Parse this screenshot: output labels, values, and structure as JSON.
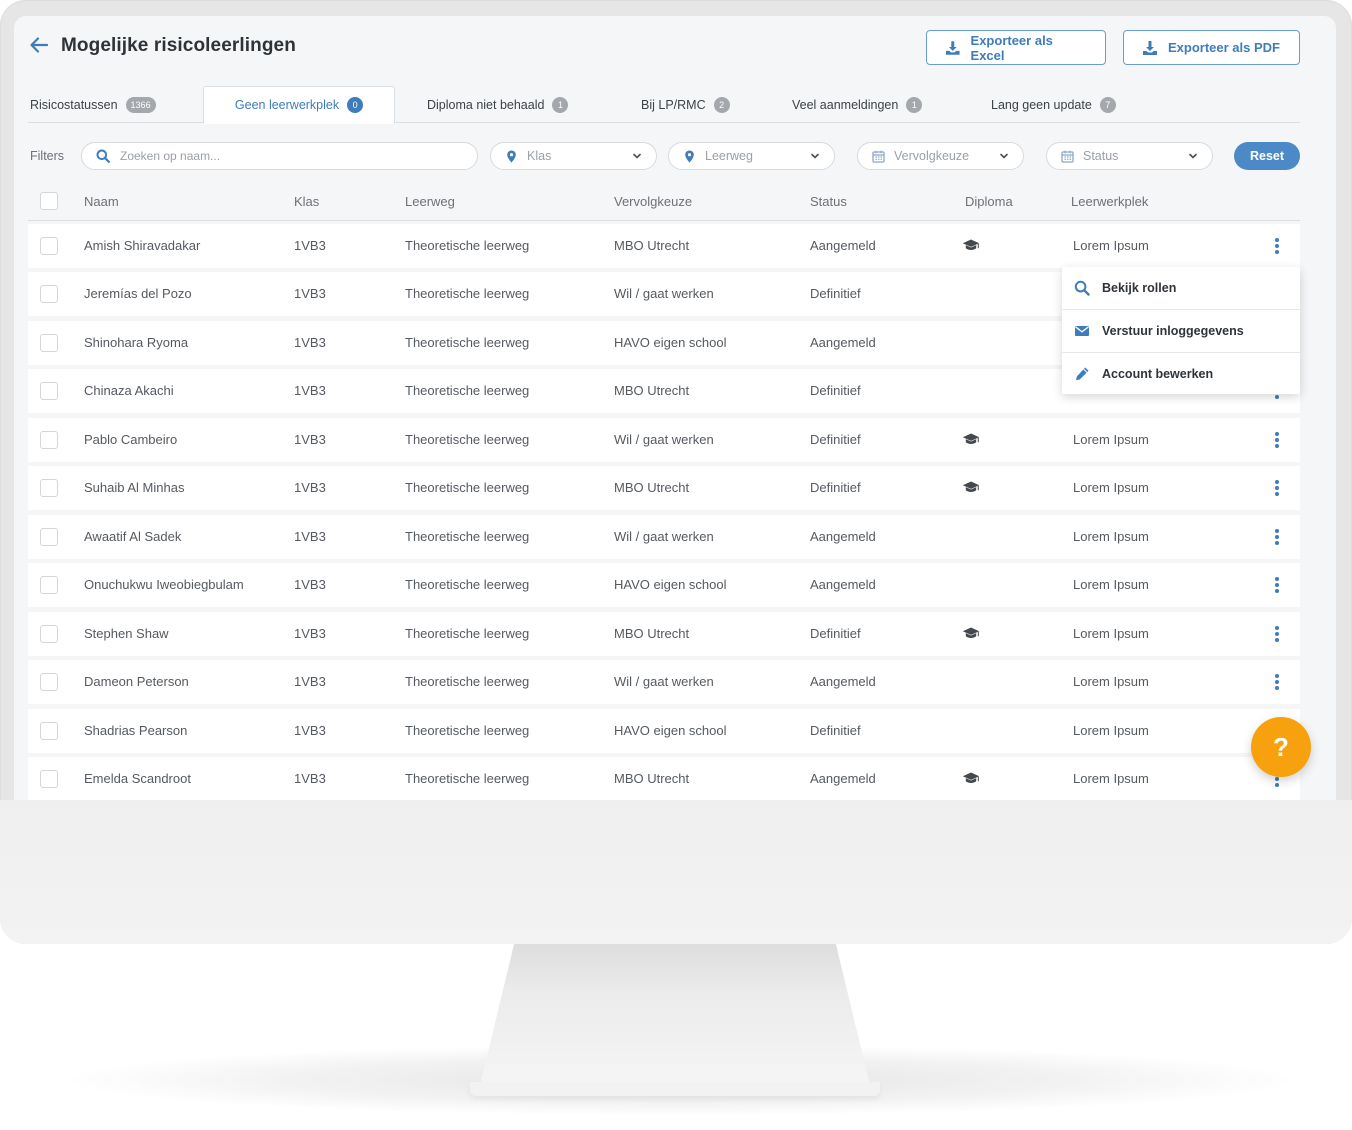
{
  "header": {
    "title": "Mogelijke risicoleerlingen",
    "export_excel_label": "Exporteer als Excel",
    "export_pdf_label": "Exporteer als PDF"
  },
  "tabs": [
    {
      "label": "Risicostatussen",
      "count": "1366",
      "active": false
    },
    {
      "label": "Geen leerwerkplek",
      "count": "0",
      "active": true
    },
    {
      "label": "Diploma niet behaald",
      "count": "1",
      "active": false
    },
    {
      "label": "Bij LP/RMC",
      "count": "2",
      "active": false
    },
    {
      "label": "Veel aanmeldingen",
      "count": "1",
      "active": false
    },
    {
      "label": "Lang geen update",
      "count": "7",
      "active": false
    }
  ],
  "filters": {
    "label": "Filters",
    "search_placeholder": "Zoeken op naam...",
    "klas": "Klas",
    "leerweg": "Leerweg",
    "vervolgkeuze": "Vervolgkeuze",
    "status": "Status",
    "reset_label": "Reset"
  },
  "table": {
    "columns": [
      "Naam",
      "Klas",
      "Leerweg",
      "Vervolgkeuze",
      "Status",
      "Diploma",
      "Leerwerkplek"
    ],
    "rows": [
      {
        "naam": "Amish Shiravadakar",
        "klas": "1VB3",
        "leerweg": "Theoretische leerweg",
        "vervolgkeuze": "MBO Utrecht",
        "status": "Aangemeld",
        "diploma": true,
        "leerwerkplek": "Lorem Ipsum"
      },
      {
        "naam": "Jeremías del Pozo",
        "klas": "1VB3",
        "leerweg": "Theoretische leerweg",
        "vervolgkeuze": "Wil / gaat werken",
        "status": "Definitief",
        "diploma": false,
        "leerwerkplek": ""
      },
      {
        "naam": "Shinohara Ryoma",
        "klas": "1VB3",
        "leerweg": "Theoretische leerweg",
        "vervolgkeuze": "HAVO eigen school",
        "status": "Aangemeld",
        "diploma": false,
        "leerwerkplek": ""
      },
      {
        "naam": "Chinaza Akachi",
        "klas": "1VB3",
        "leerweg": "Theoretische leerweg",
        "vervolgkeuze": "MBO Utrecht",
        "status": "Definitief",
        "diploma": false,
        "leerwerkplek": ""
      },
      {
        "naam": "Pablo Cambeiro",
        "klas": "1VB3",
        "leerweg": "Theoretische leerweg",
        "vervolgkeuze": "Wil / gaat werken",
        "status": "Definitief",
        "diploma": true,
        "leerwerkplek": "Lorem Ipsum"
      },
      {
        "naam": "Suhaib Al Minhas",
        "klas": "1VB3",
        "leerweg": "Theoretische leerweg",
        "vervolgkeuze": "MBO Utrecht",
        "status": "Definitief",
        "diploma": true,
        "leerwerkplek": "Lorem Ipsum"
      },
      {
        "naam": "Awaatif Al Sadek",
        "klas": "1VB3",
        "leerweg": "Theoretische leerweg",
        "vervolgkeuze": "Wil / gaat werken",
        "status": "Aangemeld",
        "diploma": false,
        "leerwerkplek": "Lorem Ipsum"
      },
      {
        "naam": "Onuchukwu Iweobiegbulam",
        "klas": "1VB3",
        "leerweg": "Theoretische leerweg",
        "vervolgkeuze": "HAVO eigen school",
        "status": "Aangemeld",
        "diploma": false,
        "leerwerkplek": "Lorem Ipsum"
      },
      {
        "naam": "Stephen Shaw",
        "klas": "1VB3",
        "leerweg": "Theoretische leerweg",
        "vervolgkeuze": "MBO Utrecht",
        "status": "Definitief",
        "diploma": true,
        "leerwerkplek": "Lorem Ipsum"
      },
      {
        "naam": "Dameon Peterson",
        "klas": "1VB3",
        "leerweg": "Theoretische leerweg",
        "vervolgkeuze": "Wil / gaat werken",
        "status": "Aangemeld",
        "diploma": false,
        "leerwerkplek": "Lorem Ipsum"
      },
      {
        "naam": "Shadrias Pearson",
        "klas": "1VB3",
        "leerweg": "Theoretische leerweg",
        "vervolgkeuze": "HAVO eigen school",
        "status": "Definitief",
        "diploma": false,
        "leerwerkplek": "Lorem Ipsum"
      },
      {
        "naam": "Emelda Scandroot",
        "klas": "1VB3",
        "leerweg": "Theoretische leerweg",
        "vervolgkeuze": "MBO Utrecht",
        "status": "Aangemeld",
        "diploma": true,
        "leerwerkplek": "Lorem Ipsum"
      }
    ]
  },
  "context_menu": {
    "items": [
      {
        "label": "Bekijk rollen",
        "icon": "search-icon"
      },
      {
        "label": "Verstuur inloggegevens",
        "icon": "envelope-icon"
      },
      {
        "label": "Account bewerken",
        "icon": "pencil-icon"
      }
    ]
  },
  "help_button": {
    "label": "?"
  },
  "colors": {
    "accent": "#3e7cbb",
    "help": "#f6a10d",
    "background": "#f5f6f7"
  }
}
